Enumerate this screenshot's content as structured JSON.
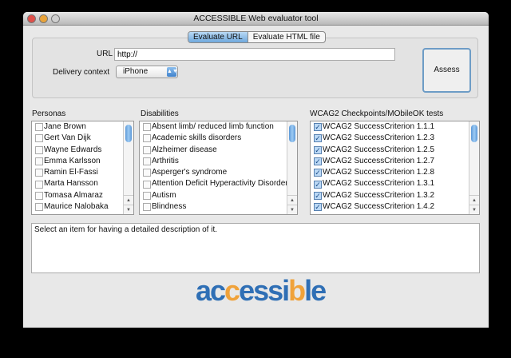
{
  "window": {
    "title": "ACCESSIBLE Web evaluator tool"
  },
  "tabs": [
    {
      "label": "Evaluate URL",
      "selected": true
    },
    {
      "label": "Evaluate HTML file",
      "selected": false
    }
  ],
  "form": {
    "url_label": "URL",
    "url_value": "http://",
    "delivery_label": "Delivery context",
    "delivery_value": "iPhone",
    "assess_label": "Assess"
  },
  "personas": {
    "title": "Personas",
    "items": [
      "Jane Brown",
      "Gert Van Dijk",
      "Wayne Edwards",
      "Emma Karlsson",
      "Ramin El-Fassi",
      "Marta Hansson",
      "Tomasa Almaraz",
      "Maurice Nalobaka"
    ]
  },
  "disabilities": {
    "title": "Disabilities",
    "items": [
      "Absent limb/ reduced limb function",
      "Academic skills disorders",
      "Alzheimer disease",
      "Arthritis",
      "Asperger's syndrome",
      "Attention Deficit Hyperactivity Disorder",
      "Autism",
      "Blindness"
    ]
  },
  "checkpoints": {
    "title": "WCAG2 Checkpoints/MObileOK tests",
    "items": [
      "WCAG2 SuccessCriterion 1.1.1",
      "WCAG2 SuccessCriterion 1.2.3",
      "WCAG2 SuccessCriterion 1.2.5",
      "WCAG2 SuccessCriterion 1.2.7",
      "WCAG2 SuccessCriterion 1.2.8",
      "WCAG2 SuccessCriterion 1.3.1",
      "WCAG2 SuccessCriterion 1.3.2",
      "WCAG2 SuccessCriterion 1.4.2"
    ]
  },
  "description": "Select an item for having a detailed description of it.",
  "logo": {
    "text": "accessible"
  }
}
